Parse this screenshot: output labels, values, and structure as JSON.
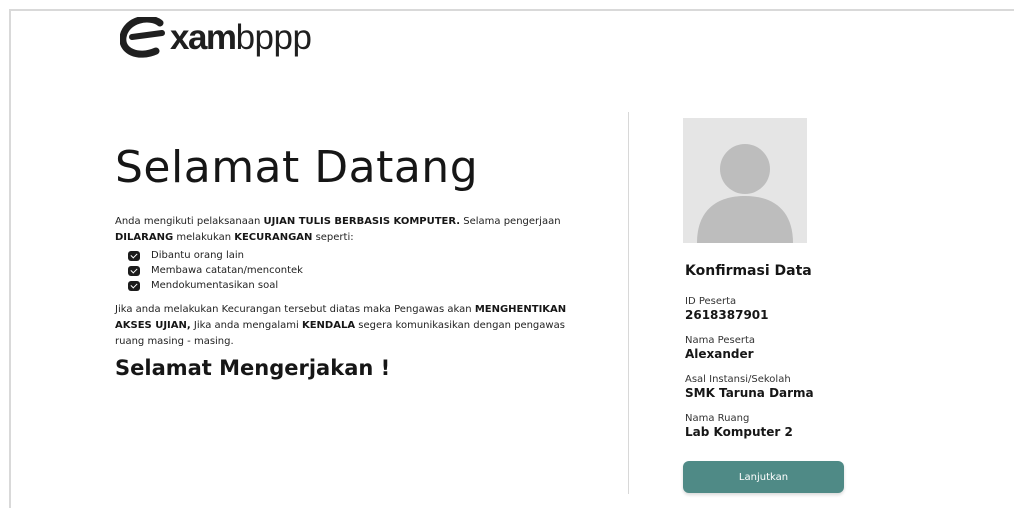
{
  "brand": {
    "logo_bold": "xam",
    "logo_light": "bppp"
  },
  "welcome": {
    "title": "Selamat Datang"
  },
  "intro": {
    "p1": "Anda mengikuti pelaksanaan ",
    "p1_b1": "UJIAN TULIS BERBASIS KOMPUTER.",
    "p2": " Selama pengerjaan ",
    "p2_b1": "DILARANG",
    "p3": " melakukan ",
    "p3_b1": "KECURANGAN",
    "p4": " seperti:"
  },
  "rules": [
    "Dibantu orang lain",
    "Membawa catatan/mencontek",
    "Mendokumentasikan soal"
  ],
  "warning": {
    "w1": "Jika anda melakukan Kecurangan tersebut diatas maka Pengawas akan ",
    "w1_b": "MENGHENTIKAN AKSES UJIAN,",
    "w2": " Jika anda mengalami ",
    "w2_b": "KENDALA",
    "w3": " segera komunikasikan dengan pengawas ruang masing - masing."
  },
  "closing": "Selamat Mengerjakan !",
  "confirm": {
    "title": "Konfirmasi Data",
    "fields": [
      {
        "label": "ID Peserta",
        "value": "2618387901"
      },
      {
        "label": "Nama Peserta",
        "value": "Alexander"
      },
      {
        "label": "Asal Instansi/Sekolah",
        "value": "SMK Taruna Darma"
      },
      {
        "label": "Nama Ruang",
        "value": "Lab Komputer 2"
      }
    ],
    "button": "Lanjutkan"
  },
  "colors": {
    "button": "#4f8a86",
    "avatar_bg": "#e5e5e5",
    "avatar_fg": "#bdbdbd"
  },
  "icons": {
    "logo": "e-swoosh-logo-icon",
    "bullet": "check-box-icon",
    "avatar": "user-placeholder-icon"
  }
}
